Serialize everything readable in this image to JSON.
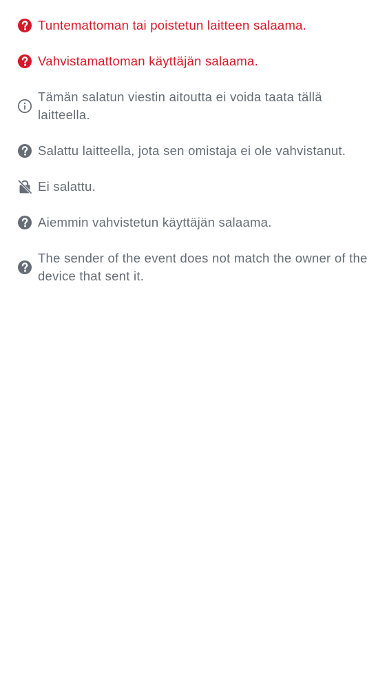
{
  "colors": {
    "critical": "#d51928",
    "normal": "#656d77"
  },
  "shields": [
    {
      "icon": "question-circle-icon",
      "severity": "critical",
      "text": "Tuntemattoman tai poistetun laitteen salaama."
    },
    {
      "icon": "question-circle-icon",
      "severity": "critical",
      "text": "Vahvistamattoman käyttäjän salaama."
    },
    {
      "icon": "info-outline-icon",
      "severity": "normal",
      "text": "Tämän salatun viestin aitoutta ei voida taata tällä laitteella."
    },
    {
      "icon": "question-circle-icon",
      "severity": "normal",
      "text": "Salattu laitteella, jota sen omistaja ei ole vahvistanut."
    },
    {
      "icon": "unlocked-crossed-icon",
      "severity": "normal",
      "text": "Ei salattu."
    },
    {
      "icon": "question-circle-icon",
      "severity": "normal",
      "text": "Aiemmin vahvistetun käyttäjän salaama."
    },
    {
      "icon": "question-circle-icon",
      "severity": "normal",
      "text": "The sender of the event does not match the owner of the device that sent it."
    }
  ]
}
